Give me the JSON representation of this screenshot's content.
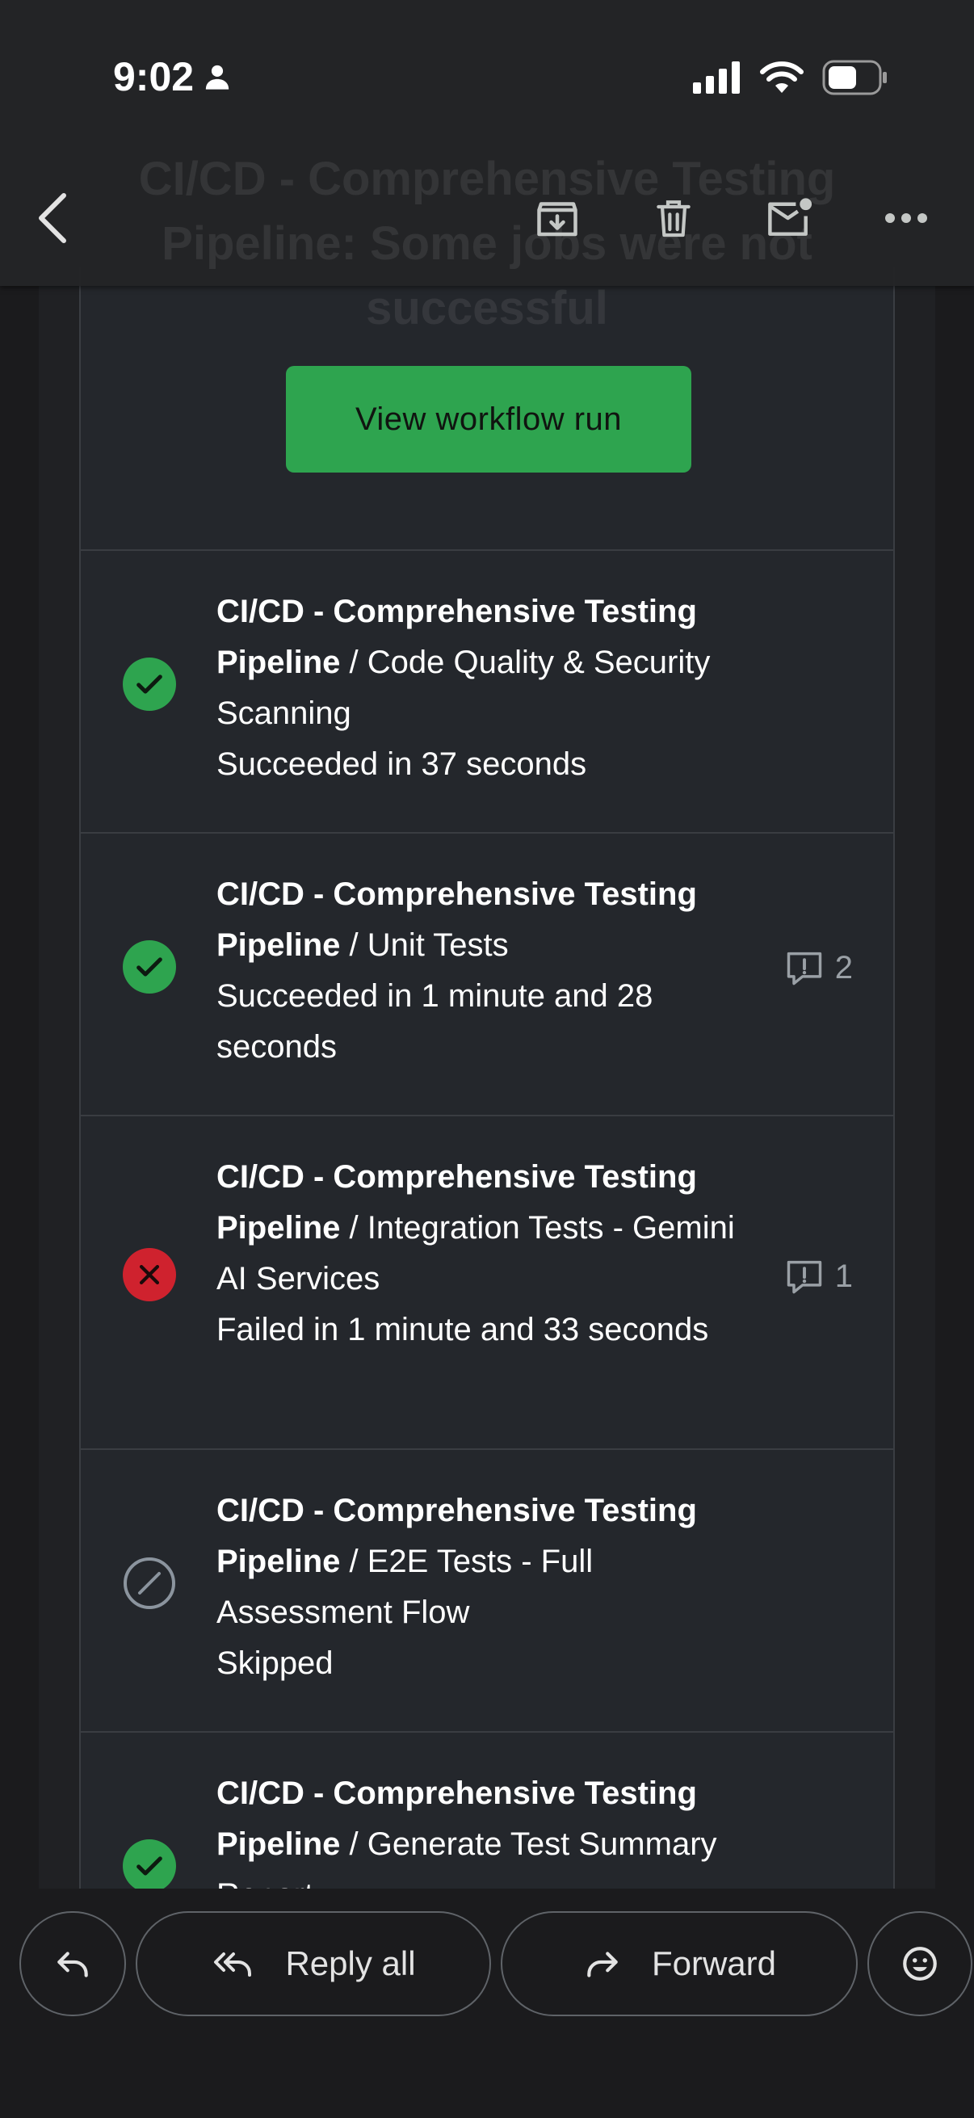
{
  "app_bar": {
    "title": "CI/CD - Comprehensive Testing Pipeline: Some jobs were not successful"
  },
  "status_bar": {
    "time": "9:02"
  },
  "email": {
    "heading_tail": "successful",
    "cta_label": "View workflow run",
    "accent_color": "#2ea44f",
    "jobs": [
      {
        "workflow": "CI/CD - Comprehensive Testing Pipeline",
        "separator": " / ",
        "job": "Code Quality & Security Scanning",
        "result": "Succeeded in 37 seconds",
        "status": "success",
        "annotations": ""
      },
      {
        "workflow": "CI/CD - Comprehensive Testing Pipeline",
        "separator": " / ",
        "job": "Unit Tests",
        "result": "Succeeded in 1 minute and 28 seconds",
        "status": "success",
        "annotations": "2"
      },
      {
        "workflow": "CI/CD - Comprehensive Testing Pipeline",
        "separator": " / ",
        "job": "Integration Tests - Gemini AI Services",
        "result": "Failed in 1 minute and 33 seconds",
        "status": "failure",
        "annotations": "1"
      },
      {
        "workflow": "CI/CD - Comprehensive Testing Pipeline",
        "separator": " / ",
        "job": "E2E Tests - Full Assessment Flow",
        "result": "Skipped",
        "status": "skipped",
        "annotations": ""
      },
      {
        "workflow": "CI/CD - Comprehensive Testing Pipeline",
        "separator": " / ",
        "job": "Generate Test Summary Report",
        "result": "",
        "status": "success",
        "annotations": ""
      }
    ]
  },
  "actions": {
    "reply_all": "Reply all",
    "forward": "Forward"
  },
  "icons": {
    "back": "chevron-left-icon",
    "archive": "archive-icon",
    "delete": "trash-icon",
    "mark_unread": "mail-unread-icon",
    "more": "more-horizontal-icon",
    "reply": "reply-icon",
    "reply_all": "reply-all-icon",
    "forward": "forward-icon",
    "emoji": "emoji-icon"
  }
}
